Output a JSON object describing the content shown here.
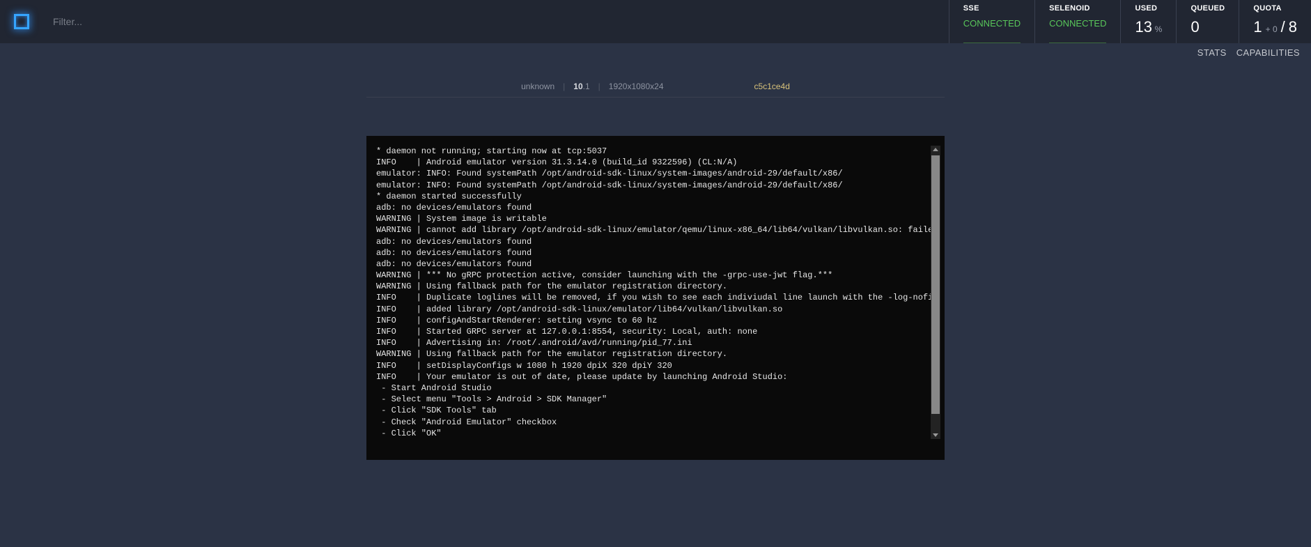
{
  "filter": {
    "placeholder": "Filter..."
  },
  "stats": {
    "sse": {
      "label": "SSE",
      "value": "CONNECTED"
    },
    "selenoid": {
      "label": "SELENOID",
      "value": "CONNECTED"
    },
    "used": {
      "label": "USED",
      "value": "13",
      "unit": "%"
    },
    "queued": {
      "label": "QUEUED",
      "value": "0"
    },
    "quota": {
      "label": "QUOTA",
      "used": "1",
      "plus_small": "+ 0",
      "slash": "/",
      "total": "8"
    }
  },
  "subnav": {
    "stats": "STATS",
    "caps": "CAPABILITIES"
  },
  "session": {
    "browser": "unknown",
    "version_prefix": "10",
    "version_suffix": ".1",
    "resolution": "1920x1080x24",
    "id": "c5c1ce4d"
  },
  "log": "* daemon not running; starting now at tcp:5037\nINFO    | Android emulator version 31.3.14.0 (build_id 9322596) (CL:N/A)\nemulator: INFO: Found systemPath /opt/android-sdk-linux/system-images/android-29/default/x86/\nemulator: INFO: Found systemPath /opt/android-sdk-linux/system-images/android-29/default/x86/\n* daemon started successfully\nadb: no devices/emulators found\nWARNING | System image is writable\nWARNING | cannot add library /opt/android-sdk-linux/emulator/qemu/linux-x86_64/lib64/vulkan/libvulkan.so: failed\nadb: no devices/emulators found\nadb: no devices/emulators found\nadb: no devices/emulators found\nWARNING | *** No gRPC protection active, consider launching with the -grpc-use-jwt flag.***\nWARNING | Using fallback path for the emulator registration directory.\nINFO    | Duplicate loglines will be removed, if you wish to see each indiviudal line launch with the -log-nofilter flag.\nINFO    | added library /opt/android-sdk-linux/emulator/lib64/vulkan/libvulkan.so\nINFO    | configAndStartRenderer: setting vsync to 60 hz\nINFO    | Started GRPC server at 127.0.0.1:8554, security: Local, auth: none\nINFO    | Advertising in: /root/.android/avd/running/pid_77.ini\nWARNING | Using fallback path for the emulator registration directory.\nINFO    | setDisplayConfigs w 1080 h 1920 dpiX 320 dpiY 320\nINFO    | Your emulator is out of date, please update by launching Android Studio:\n - Start Android Studio\n - Select menu \"Tools > Android > SDK Manager\"\n - Click \"SDK Tools\" tab\n - Check \"Android Emulator\" checkbox\n - Click \"OK\""
}
